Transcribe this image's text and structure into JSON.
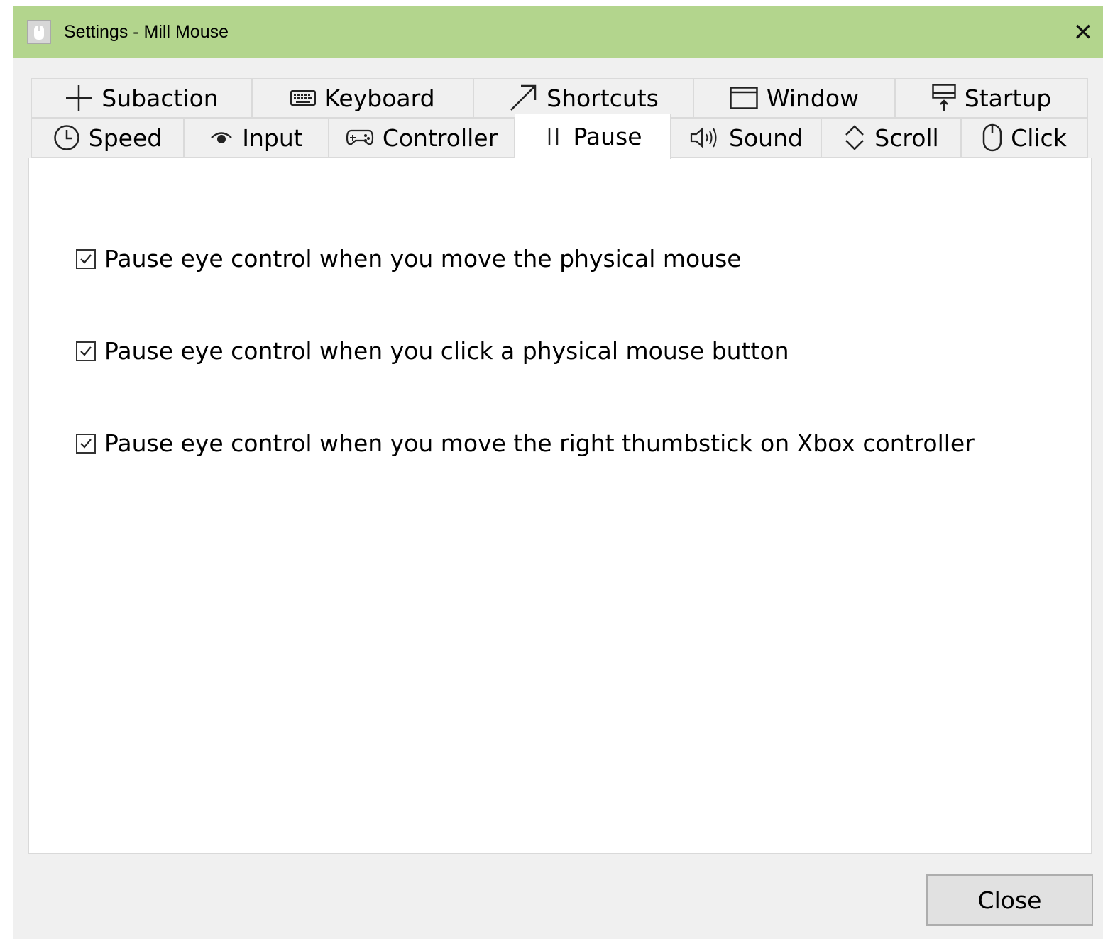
{
  "window": {
    "title": "Settings - Mill Mouse",
    "titlebar_color": "#b3d58d",
    "close_glyph": "✕"
  },
  "tabs_top": [
    {
      "label": "Subaction",
      "icon": "plus-icon"
    },
    {
      "label": "Keyboard",
      "icon": "keyboard-icon"
    },
    {
      "label": "Shortcuts",
      "icon": "arrow-up-right-icon"
    },
    {
      "label": "Window",
      "icon": "window-icon"
    },
    {
      "label": "Startup",
      "icon": "startup-icon"
    }
  ],
  "tabs_bottom": [
    {
      "label": "Speed",
      "icon": "clock-icon"
    },
    {
      "label": "Input",
      "icon": "eye-icon"
    },
    {
      "label": "Controller",
      "icon": "gamepad-icon"
    },
    {
      "label": "Pause",
      "icon": "pause-icon",
      "active": true
    },
    {
      "label": "Sound",
      "icon": "speaker-icon"
    },
    {
      "label": "Scroll",
      "icon": "scroll-icon"
    },
    {
      "label": "Click",
      "icon": "mouse-icon"
    }
  ],
  "options": [
    {
      "label": "Pause eye control when you move the physical mouse",
      "checked": true
    },
    {
      "label": "Pause eye control when you click a physical mouse button",
      "checked": true
    },
    {
      "label": "Pause eye control when you move the right thumbstick on Xbox controller",
      "checked": true
    }
  ],
  "footer": {
    "close_label": "Close"
  }
}
